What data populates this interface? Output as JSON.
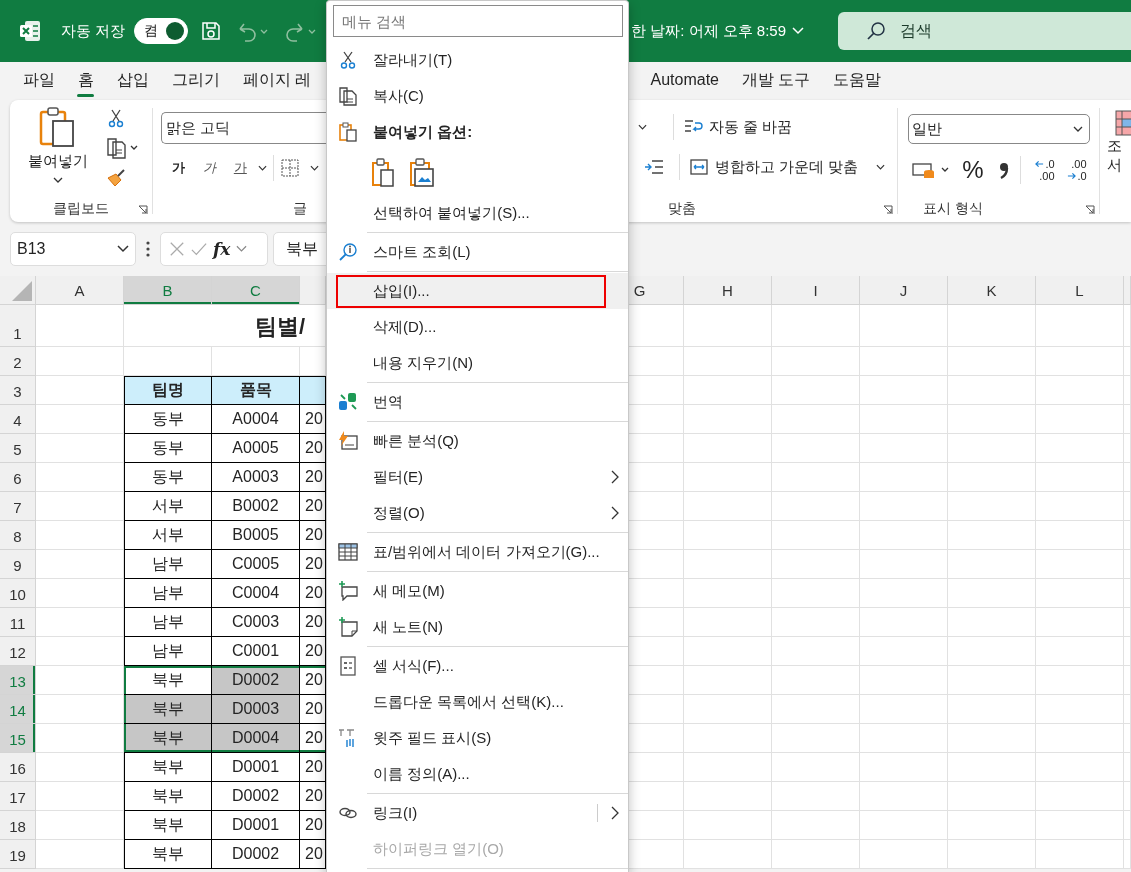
{
  "title_bar": {
    "autosave_label": "자동 저장",
    "autosave": {
      "label": "켬",
      "on": true
    },
    "saved_info": "한 날짜: 어제 오후 8:59",
    "search": {
      "placeholder": "검색"
    }
  },
  "tabs_left": [
    {
      "label": "파일",
      "selected": false
    },
    {
      "label": "홈",
      "selected": true
    },
    {
      "label": "삽입",
      "selected": false
    },
    {
      "label": "그리기",
      "selected": false
    },
    {
      "label": "페이지 레",
      "selected": false
    }
  ],
  "tabs_right": [
    {
      "label": "Automate",
      "selected": false
    },
    {
      "label": "개발 도구",
      "selected": false
    },
    {
      "label": "도움말",
      "selected": false
    }
  ],
  "ribbon": {
    "clipboard": {
      "paste": "붙여넣기",
      "group_label": "클립보드"
    },
    "font": {
      "font_name": "맑은 고딕",
      "bold": "가",
      "italic": "가",
      "underline": "가",
      "group_label": "글"
    },
    "alignment": {
      "wrap_text": "자동 줄 바꿈",
      "merge_center": "병합하고 가운데 맞춤",
      "group_label": "맞춤"
    },
    "number": {
      "format": "일반",
      "percent": "%",
      "increase_decimal": {
        "top": ".0",
        "bottom": ".00"
      },
      "decrease_decimal": {
        "top": ".00",
        "bottom": ".0"
      },
      "group_label": "표시 형식"
    },
    "styles": {
      "lines": [
        "조",
        "서"
      ]
    }
  },
  "formula_bar": {
    "name_box": "B13",
    "fx": "fx",
    "formula": "북부"
  },
  "sheet": {
    "columns_left": [
      {
        "label": "A",
        "selected": false
      },
      {
        "label": "B",
        "selected": true
      },
      {
        "label": "C",
        "selected": true
      }
    ],
    "columns_right": [
      {
        "label": "G",
        "selected": false
      },
      {
        "label": "H",
        "selected": false
      },
      {
        "label": "I",
        "selected": false
      },
      {
        "label": "J",
        "selected": false
      },
      {
        "label": "K",
        "selected": false
      },
      {
        "label": "L",
        "selected": false
      }
    ],
    "rows": [
      {
        "number": "1",
        "selected": false,
        "kind": "title",
        "title": "팀별/"
      },
      {
        "number": "2",
        "selected": false,
        "kind": "blank"
      },
      {
        "number": "3",
        "selected": false,
        "kind": "header",
        "b": "팀명",
        "c": "품목"
      },
      {
        "number": "4",
        "selected": false,
        "kind": "data",
        "b": "동부",
        "c": "A0004",
        "d": "20",
        "b_shaded": false,
        "c_shaded": false
      },
      {
        "number": "5",
        "selected": false,
        "kind": "data",
        "b": "동부",
        "c": "A0005",
        "d": "20",
        "b_shaded": false,
        "c_shaded": false
      },
      {
        "number": "6",
        "selected": false,
        "kind": "data",
        "b": "동부",
        "c": "A0003",
        "d": "20",
        "b_shaded": false,
        "c_shaded": false
      },
      {
        "number": "7",
        "selected": false,
        "kind": "data",
        "b": "서부",
        "c": "B0002",
        "d": "20",
        "b_shaded": false,
        "c_shaded": false
      },
      {
        "number": "8",
        "selected": false,
        "kind": "data",
        "b": "서부",
        "c": "B0005",
        "d": "20",
        "b_shaded": false,
        "c_shaded": false
      },
      {
        "number": "9",
        "selected": false,
        "kind": "data",
        "b": "남부",
        "c": "C0005",
        "d": "20",
        "b_shaded": false,
        "c_shaded": false
      },
      {
        "number": "10",
        "selected": false,
        "kind": "data",
        "b": "남부",
        "c": "C0004",
        "d": "20",
        "b_shaded": false,
        "c_shaded": false
      },
      {
        "number": "11",
        "selected": false,
        "kind": "data",
        "b": "남부",
        "c": "C0003",
        "d": "20",
        "b_shaded": false,
        "c_shaded": false
      },
      {
        "number": "12",
        "selected": false,
        "kind": "data",
        "b": "남부",
        "c": "C0001",
        "d": "20",
        "b_shaded": false,
        "c_shaded": false
      },
      {
        "number": "13",
        "selected": true,
        "kind": "data",
        "b": "북부",
        "c": "D0002",
        "d": "20",
        "b_shaded": false,
        "c_shaded": true
      },
      {
        "number": "14",
        "selected": true,
        "kind": "data",
        "b": "북부",
        "c": "D0003",
        "d": "20",
        "b_shaded": true,
        "c_shaded": true
      },
      {
        "number": "15",
        "selected": true,
        "kind": "data",
        "b": "북부",
        "c": "D0004",
        "d": "20",
        "b_shaded": true,
        "c_shaded": true
      },
      {
        "number": "16",
        "selected": false,
        "kind": "data",
        "b": "북부",
        "c": "D0001",
        "d": "20",
        "b_shaded": false,
        "c_shaded": false
      },
      {
        "number": "17",
        "selected": false,
        "kind": "data",
        "b": "북부",
        "c": "D0002",
        "d": "20",
        "b_shaded": false,
        "c_shaded": false
      },
      {
        "number": "18",
        "selected": false,
        "kind": "data",
        "b": "북부",
        "c": "D0001",
        "d": "20",
        "b_shaded": false,
        "c_shaded": false
      },
      {
        "number": "19",
        "selected": false,
        "kind": "data",
        "b": "북부",
        "c": "D0002",
        "d": "20",
        "b_shaded": false,
        "c_shaded": false
      }
    ]
  },
  "context_menu": {
    "search": {
      "placeholder": "메뉴 검색"
    },
    "items": [
      {
        "kind": "item",
        "label": "잘라내기(T)",
        "submenu": false,
        "disabled": false,
        "highlighted": false
      },
      {
        "kind": "item",
        "label": "복사(C)",
        "submenu": false,
        "disabled": false,
        "highlighted": false
      },
      {
        "kind": "header",
        "label": "붙여넣기 옵션:"
      },
      {
        "kind": "paste_options"
      },
      {
        "kind": "item",
        "label": "선택하여 붙여넣기(S)...",
        "submenu": false,
        "disabled": false,
        "highlighted": false
      },
      {
        "kind": "separator"
      },
      {
        "kind": "item",
        "label": "스마트 조회(L)",
        "submenu": false,
        "disabled": false,
        "highlighted": false
      },
      {
        "kind": "separator"
      },
      {
        "kind": "item",
        "label": "삽입(I)...",
        "submenu": false,
        "disabled": false,
        "highlighted": true
      },
      {
        "kind": "item",
        "label": "삭제(D)...",
        "submenu": false,
        "disabled": false,
        "highlighted": false
      },
      {
        "kind": "item",
        "label": "내용 지우기(N)",
        "submenu": false,
        "disabled": false,
        "highlighted": false
      },
      {
        "kind": "separator"
      },
      {
        "kind": "item",
        "label": "번역",
        "submenu": false,
        "disabled": false,
        "highlighted": false
      },
      {
        "kind": "separator"
      },
      {
        "kind": "item",
        "label": "빠른 분석(Q)",
        "submenu": false,
        "disabled": false,
        "highlighted": false
      },
      {
        "kind": "item",
        "label": "필터(E)",
        "submenu": true,
        "disabled": false,
        "highlighted": false
      },
      {
        "kind": "item",
        "label": "정렬(O)",
        "submenu": true,
        "disabled": false,
        "highlighted": false
      },
      {
        "kind": "separator"
      },
      {
        "kind": "item",
        "label": "표/범위에서 데이터 가져오기(G)...",
        "submenu": false,
        "disabled": false,
        "highlighted": false
      },
      {
        "kind": "separator"
      },
      {
        "kind": "item",
        "label": "새 메모(M)",
        "submenu": false,
        "disabled": false,
        "highlighted": false
      },
      {
        "kind": "item",
        "label": "새 노트(N)",
        "submenu": false,
        "disabled": false,
        "highlighted": false
      },
      {
        "kind": "separator"
      },
      {
        "kind": "item",
        "label": "셀 서식(F)...",
        "submenu": false,
        "disabled": false,
        "highlighted": false
      },
      {
        "kind": "item",
        "label": "드롭다운 목록에서 선택(K)...",
        "submenu": false,
        "disabled": false,
        "highlighted": false
      },
      {
        "kind": "item",
        "label": "윗주 필드 표시(S)",
        "submenu": false,
        "disabled": false,
        "highlighted": false
      },
      {
        "kind": "item",
        "label": "이름 정의(A)...",
        "submenu": false,
        "disabled": false,
        "highlighted": false
      },
      {
        "kind": "separator"
      },
      {
        "kind": "split_item",
        "label": "링크(I)",
        "submenu": true,
        "disabled": false,
        "highlighted": false
      },
      {
        "kind": "item",
        "label": "하이퍼링크 열기(O)",
        "submenu": false,
        "disabled": true,
        "highlighted": false
      },
      {
        "kind": "separator"
      }
    ]
  }
}
